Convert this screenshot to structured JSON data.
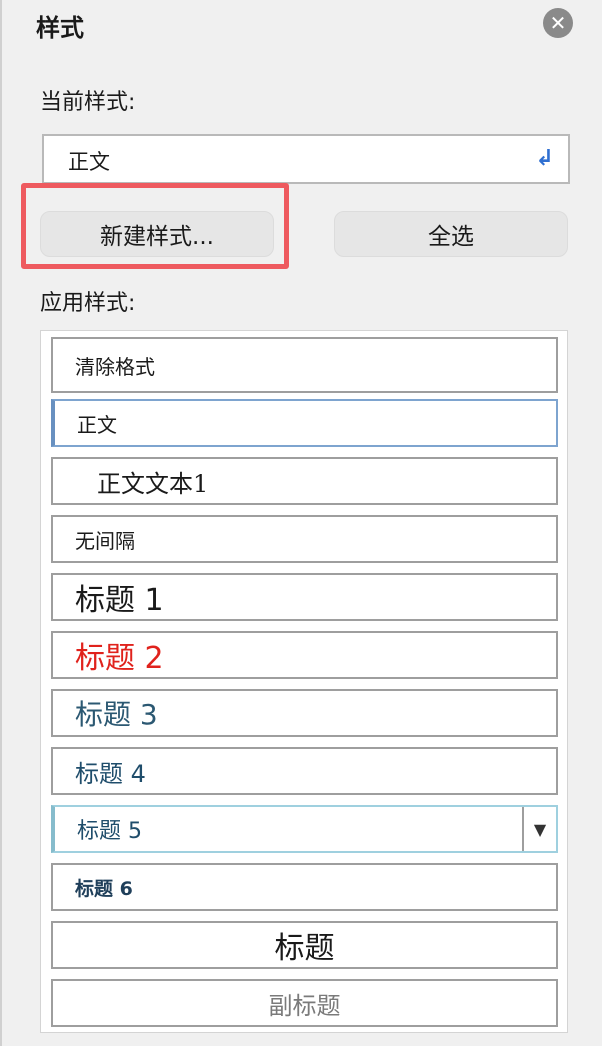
{
  "header": {
    "title": "样式",
    "close_icon": "close-icon"
  },
  "current": {
    "label": "当前样式:",
    "value": "正文",
    "icon": "pilcrow-icon"
  },
  "buttons": {
    "new_style": "新建样式...",
    "select_all": "全选"
  },
  "apply": {
    "label": "应用样式:"
  },
  "styles": [
    {
      "label": "清除格式"
    },
    {
      "label": "正文"
    },
    {
      "label": "正文文本1"
    },
    {
      "label": "无间隔"
    },
    {
      "label": "标题 1"
    },
    {
      "label": "标题 2",
      "color": "#e0221c"
    },
    {
      "label": "标题 3",
      "color": "#2b5872"
    },
    {
      "label": "标题 4",
      "color": "#1f4d6b"
    },
    {
      "label": "标题 5",
      "color": "#1f4d6b"
    },
    {
      "label": "标题 6",
      "color": "#1f3f5a"
    },
    {
      "label": "标题"
    },
    {
      "label": "副标题",
      "color": "#7a7a7a"
    }
  ],
  "colors": {
    "highlight": "#ee5a5f",
    "accent": "#2f6fd1"
  }
}
